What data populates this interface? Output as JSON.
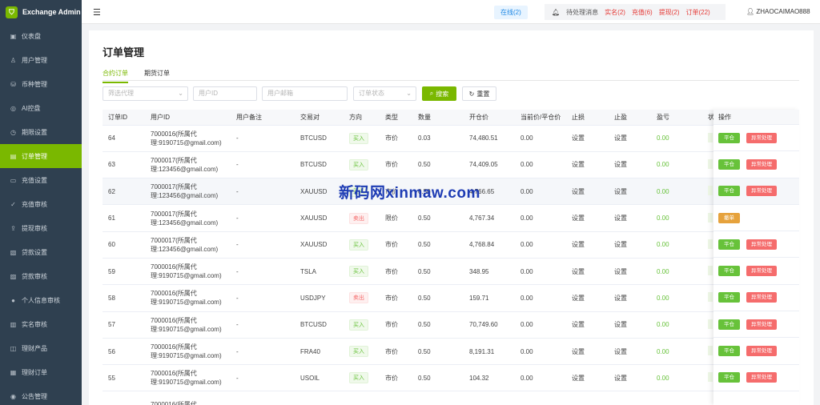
{
  "sidebar": {
    "app_title": "Exchange Admin",
    "items": [
      {
        "label": "仪表盘",
        "icon": "dashboard-icon"
      },
      {
        "label": "用户管理",
        "icon": "user-icon"
      },
      {
        "label": "币种管理",
        "icon": "database-icon"
      },
      {
        "label": "AI控盘",
        "icon": "ai-icon"
      },
      {
        "label": "期限设置",
        "icon": "timer-icon"
      },
      {
        "label": "订单管理",
        "icon": "document-icon",
        "active": true
      },
      {
        "label": "充值设置",
        "icon": "wallet-icon"
      },
      {
        "label": "充值审核",
        "icon": "check-icon"
      },
      {
        "label": "提现审核",
        "icon": "withdraw-icon"
      },
      {
        "label": "贷款设置",
        "icon": "loan-settings-icon"
      },
      {
        "label": "贷款审核",
        "icon": "loan-review-icon"
      },
      {
        "label": "个人信息审核",
        "icon": "person-icon"
      },
      {
        "label": "实名审核",
        "icon": "id-card-icon"
      },
      {
        "label": "理财产品",
        "icon": "product-icon"
      },
      {
        "label": "理财订单",
        "icon": "order-icon"
      },
      {
        "label": "公告管理",
        "icon": "notice-icon"
      }
    ]
  },
  "topbar": {
    "online": "在线(2)",
    "pending": "待处理消息",
    "realname": "实名(2)",
    "recharge": "充值(6)",
    "withdraw": "提现(2)",
    "orders": "订单(22)",
    "username": "ZHAOCAIMAO888"
  },
  "page": {
    "title": "订单管理",
    "tabs": [
      "合约订单",
      "期货订单"
    ]
  },
  "filters": {
    "agent_placeholder": "筛选代理",
    "userid_placeholder": "用户ID",
    "email_placeholder": "用户邮箱",
    "status_placeholder": "订单状态",
    "search_label": "搜索",
    "reset_label": "重置"
  },
  "table": {
    "headers": [
      "订单ID",
      "用户ID",
      "用户备注",
      "交易对",
      "方向",
      "类型",
      "数量",
      "开仓价",
      "当前价/平仓价",
      "止损",
      "止盈",
      "盈亏",
      "状"
    ],
    "ops_header": "操作",
    "rows": [
      {
        "id": "64",
        "user_l1": "7000016(所属代",
        "user_l2": "理:9190715@gmail.com)",
        "note": "-",
        "pair": "BTCUSD",
        "dir": "买入",
        "dir_type": "buy",
        "type": "市价",
        "qty": "0.03",
        "open": "74,480.51",
        "cur": "0.00",
        "sl": "设置",
        "tp": "设置",
        "pnl": "0.00",
        "ops": [
          "平仓",
          "异常处理"
        ]
      },
      {
        "id": "63",
        "user_l1": "7000017(所属代",
        "user_l2": "理:123456@gmail.com)",
        "note": "-",
        "pair": "BTCUSD",
        "dir": "买入",
        "dir_type": "buy",
        "type": "市价",
        "qty": "0.50",
        "open": "74,409.05",
        "cur": "0.00",
        "sl": "设置",
        "tp": "设置",
        "pnl": "0.00",
        "ops": [
          "平仓",
          "异常处理"
        ]
      },
      {
        "id": "62",
        "user_l1": "7000017(所属代",
        "user_l2": "理:123456@gmail.com)",
        "note": "-",
        "pair": "XAUUSD",
        "dir": "买入",
        "dir_type": "buy",
        "type": "市价",
        "qty": "0.50",
        "open": "4,766.65",
        "cur": "0.00",
        "sl": "设置",
        "tp": "设置",
        "pnl": "0.00",
        "ops": [
          "平仓",
          "异常处理"
        ],
        "hl": true
      },
      {
        "id": "61",
        "user_l1": "7000017(所属代",
        "user_l2": "理:123456@gmail.com)",
        "note": "-",
        "pair": "XAUUSD",
        "dir": "卖出",
        "dir_type": "sell",
        "type": "限价",
        "qty": "0.50",
        "open": "4,767.34",
        "cur": "0.00",
        "sl": "设置",
        "tp": "设置",
        "pnl": "0.00",
        "ops": [
          "撤单"
        ]
      },
      {
        "id": "60",
        "user_l1": "7000017(所属代",
        "user_l2": "理:123456@gmail.com)",
        "note": "-",
        "pair": "XAUUSD",
        "dir": "买入",
        "dir_type": "buy",
        "type": "市价",
        "qty": "0.50",
        "open": "4,768.84",
        "cur": "0.00",
        "sl": "设置",
        "tp": "设置",
        "pnl": "0.00",
        "ops": [
          "平仓",
          "异常处理"
        ]
      },
      {
        "id": "59",
        "user_l1": "7000016(所属代",
        "user_l2": "理:9190715@gmail.com)",
        "note": "-",
        "pair": "TSLA",
        "dir": "买入",
        "dir_type": "buy",
        "type": "市价",
        "qty": "0.50",
        "open": "348.95",
        "cur": "0.00",
        "sl": "设置",
        "tp": "设置",
        "pnl": "0.00",
        "ops": [
          "平仓",
          "异常处理"
        ]
      },
      {
        "id": "58",
        "user_l1": "7000016(所属代",
        "user_l2": "理:9190715@gmail.com)",
        "note": "-",
        "pair": "USDJPY",
        "dir": "卖出",
        "dir_type": "sell",
        "type": "市价",
        "qty": "0.50",
        "open": "159.71",
        "cur": "0.00",
        "sl": "设置",
        "tp": "设置",
        "pnl": "0.00",
        "ops": [
          "平仓",
          "异常处理"
        ]
      },
      {
        "id": "57",
        "user_l1": "7000016(所属代",
        "user_l2": "理:9190715@gmail.com)",
        "note": "-",
        "pair": "BTCUSD",
        "dir": "买入",
        "dir_type": "buy",
        "type": "市价",
        "qty": "0.50",
        "open": "70,749.60",
        "cur": "0.00",
        "sl": "设置",
        "tp": "设置",
        "pnl": "0.00",
        "ops": [
          "平仓",
          "异常处理"
        ]
      },
      {
        "id": "56",
        "user_l1": "7000016(所属代",
        "user_l2": "理:9190715@gmail.com)",
        "note": "-",
        "pair": "FRA40",
        "dir": "买入",
        "dir_type": "buy",
        "type": "市价",
        "qty": "0.50",
        "open": "8,191.31",
        "cur": "0.00",
        "sl": "设置",
        "tp": "设置",
        "pnl": "0.00",
        "ops": [
          "平仓",
          "异常处理"
        ]
      },
      {
        "id": "55",
        "user_l1": "7000016(所属代",
        "user_l2": "理:9190715@gmail.com)",
        "note": "-",
        "pair": "USOIL",
        "dir": "买入",
        "dir_type": "buy",
        "type": "市价",
        "qty": "0.50",
        "open": "104.32",
        "cur": "0.00",
        "sl": "设置",
        "tp": "设置",
        "pnl": "0.00",
        "ops": [
          "平仓",
          "异常处理"
        ]
      },
      {
        "id": "",
        "user_l1": "7000016(所属代",
        "user_l2": "",
        "note": "",
        "pair": "",
        "dir": "",
        "dir_type": "",
        "type": "",
        "qty": "",
        "open": "",
        "cur": "",
        "sl": "",
        "tp": "",
        "pnl": "",
        "ops": []
      }
    ]
  },
  "watermark": "新码网xinmaw.com",
  "colors": {
    "sidebar_bg": "#2f4050",
    "accent": "#7ab800",
    "danger": "#f56c6c",
    "warning": "#e6a23c"
  }
}
